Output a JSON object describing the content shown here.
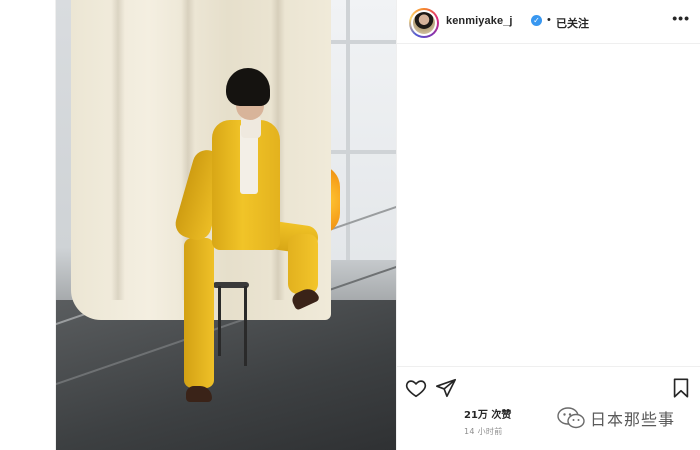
{
  "post": {
    "author": {
      "username": "kenmiyake_j",
      "verified_icon": "verified-badge-icon",
      "separator": "•",
      "follow_status": "已关注",
      "more_icon": "more-options-icon",
      "more_label": "•••"
    },
    "photo": {
      "description_icon": "post-photo"
    },
    "actions": {
      "like_icon": "heart-outline-icon",
      "share_icon": "paper-plane-icon",
      "save_icon": "bookmark-outline-icon"
    },
    "likes_text": "21万 次赞",
    "timestamp": "14 小时前"
  },
  "watermark": {
    "icon": "wechat-icon",
    "text": "日本那些事"
  },
  "colors": {
    "verified_blue": "#3897f0",
    "text_primary": "#262626",
    "text_secondary": "#8e8e8e",
    "suit_yellow": "#f1c428"
  }
}
